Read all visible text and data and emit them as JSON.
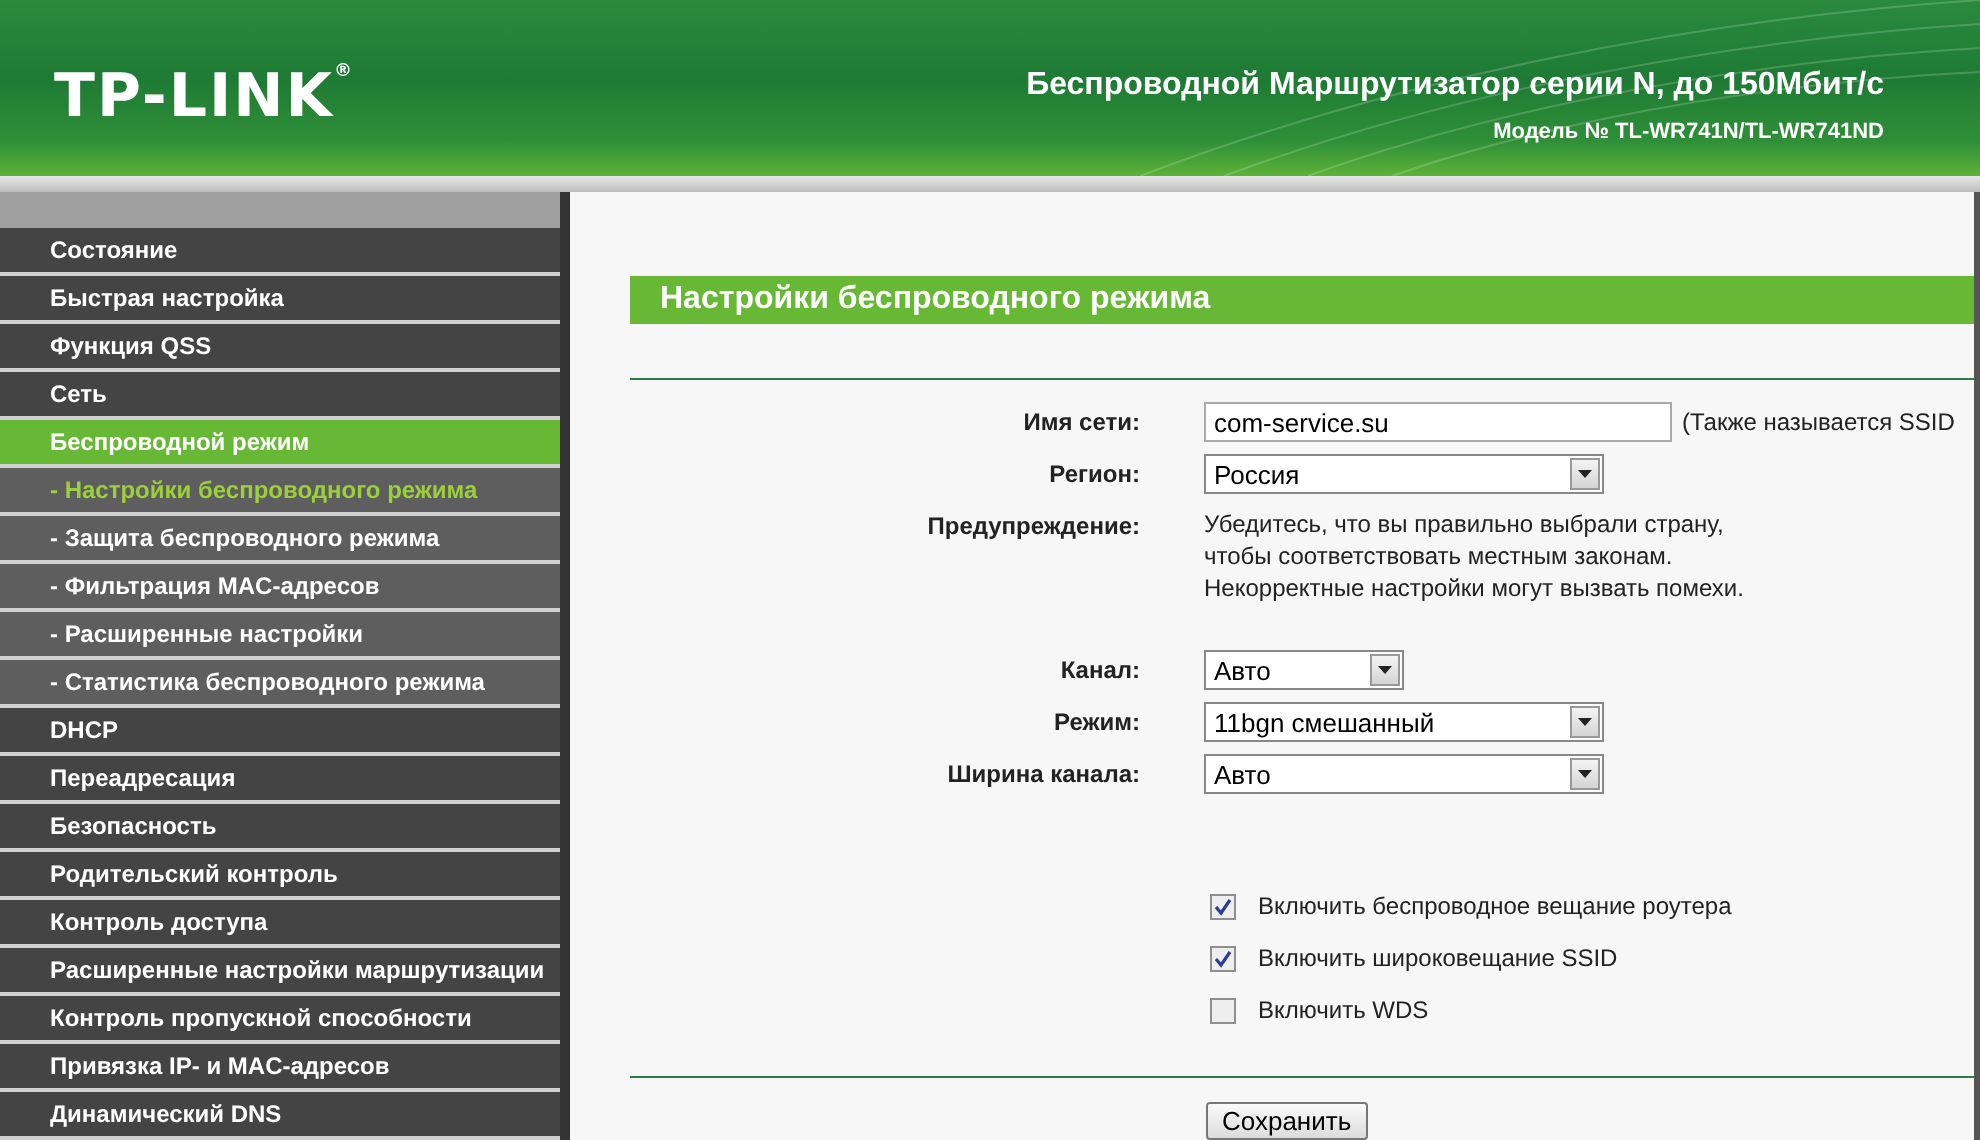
{
  "header": {
    "logo": "TP-LINK",
    "registered": "®",
    "title": "Беспроводной Маршрутизатор серии N, до 150Мбит/с",
    "model": "Модель № TL-WR741N/TL-WR741ND"
  },
  "sidebar": {
    "items": [
      {
        "label": "Состояние",
        "kind": "main",
        "selected": false
      },
      {
        "label": "Быстрая настройка",
        "kind": "main",
        "selected": false
      },
      {
        "label": "Функция QSS",
        "kind": "main",
        "selected": false
      },
      {
        "label": "Сеть",
        "kind": "main",
        "selected": false
      },
      {
        "label": "Беспроводной режим",
        "kind": "main",
        "selected": true
      },
      {
        "label": "- Настройки беспроводного режима",
        "kind": "sub",
        "selected": true
      },
      {
        "label": "- Защита беспроводного режима",
        "kind": "sub",
        "selected": false
      },
      {
        "label": "- Фильтрация MAC-адресов",
        "kind": "sub",
        "selected": false
      },
      {
        "label": "- Расширенные настройки",
        "kind": "sub",
        "selected": false
      },
      {
        "label": "- Статистика беспроводного режима",
        "kind": "sub",
        "selected": false
      },
      {
        "label": "DHCP",
        "kind": "main",
        "selected": false
      },
      {
        "label": "Переадресация",
        "kind": "main",
        "selected": false
      },
      {
        "label": "Безопасность",
        "kind": "main",
        "selected": false
      },
      {
        "label": "Родительский контроль",
        "kind": "main",
        "selected": false
      },
      {
        "label": "Контроль доступа",
        "kind": "main",
        "selected": false
      },
      {
        "label": "Расширенные настройки маршрутизации",
        "kind": "main",
        "selected": false
      },
      {
        "label": "Контроль пропускной способности",
        "kind": "main",
        "selected": false
      },
      {
        "label": "Привязка IP- и MAC-адресов",
        "kind": "main",
        "selected": false
      },
      {
        "label": "Динамический DNS",
        "kind": "main",
        "selected": false
      }
    ]
  },
  "content": {
    "title": "Настройки беспроводного режима",
    "fields": [
      {
        "kind": "input",
        "label": "Имя сети:",
        "value": "com-service.su",
        "hint": "(Также называется SSID"
      },
      {
        "kind": "select",
        "label": "Регион:",
        "value": "Россия"
      },
      {
        "kind": "note",
        "label": "Предупреждение:",
        "lines": [
          "Убедитесь, что вы правильно выбрали страну,",
          "чтобы соответствовать местным законам.",
          "Некорректные настройки могут вызвать помехи."
        ]
      },
      {
        "kind": "short_select",
        "label": "Канал:",
        "value": "Авто"
      },
      {
        "kind": "select",
        "label": "Режим:",
        "value": "11bgn смешанный"
      },
      {
        "kind": "select",
        "label": "Ширина канала:",
        "value": "Авто"
      }
    ],
    "checkboxes": [
      {
        "label": "Включить беспроводное вещание роутера",
        "checked": true
      },
      {
        "label": "Включить широковещание SSID",
        "checked": true
      },
      {
        "label": "Включить WDS",
        "checked": false
      }
    ],
    "save_button": "Сохранить"
  }
}
